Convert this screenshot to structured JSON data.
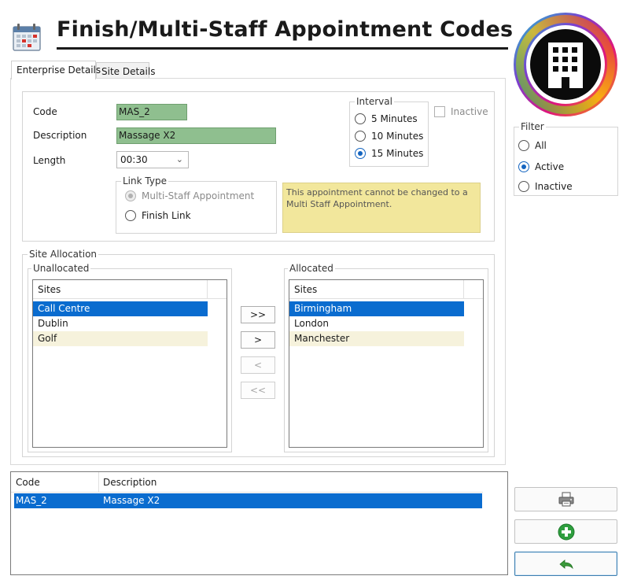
{
  "header": {
    "title": "Finish/Multi-Staff Appointment Codes"
  },
  "tabs": [
    {
      "label": "Enterprise Details",
      "active": true
    },
    {
      "label": "Site Details",
      "active": false
    }
  ],
  "form": {
    "code_label": "Code",
    "code_value": "MAS_2",
    "description_label": "Description",
    "description_value": "Massage X2",
    "length_label": "Length",
    "length_value": "00:30",
    "inactive_label": "Inactive",
    "inactive_checked": false
  },
  "interval": {
    "legend": "Interval",
    "options": [
      {
        "label": "5 Minutes",
        "selected": false
      },
      {
        "label": "10 Minutes",
        "selected": false
      },
      {
        "label": "15 Minutes",
        "selected": true
      }
    ]
  },
  "link_type": {
    "legend": "Link Type",
    "options": [
      {
        "label": "Multi-Staff Appointment",
        "selected": true,
        "disabled": true
      },
      {
        "label": "Finish Link",
        "selected": false,
        "disabled": false
      }
    ]
  },
  "note": "This appointment cannot be changed to a Multi Staff Appointment.",
  "site_allocation": {
    "legend": "Site Allocation",
    "unallocated": {
      "legend": "Unallocated",
      "header": "Sites",
      "items": [
        "Call Centre",
        "Dublin",
        "Golf"
      ]
    },
    "allocated": {
      "legend": "Allocated",
      "header": "Sites",
      "items": [
        "Birmingham",
        "London",
        "Manchester"
      ]
    },
    "buttons": {
      "move_all_right": ">>",
      "move_right": ">",
      "move_left": "<",
      "move_all_left": "<<"
    }
  },
  "grid": {
    "columns": [
      "Code",
      "Description"
    ],
    "rows": [
      {
        "code": "MAS_2",
        "description": "Massage X2"
      }
    ]
  },
  "filter": {
    "legend": "Filter",
    "options": [
      {
        "label": "All",
        "selected": false
      },
      {
        "label": "Active",
        "selected": true
      },
      {
        "label": "Inactive",
        "selected": false
      }
    ]
  },
  "actions": {
    "print_icon": "printer-icon",
    "add_icon": "plus-circle-icon",
    "undo_icon": "undo-arrow-icon"
  },
  "colors": {
    "selection": "#0a6ccf",
    "required_field": "#8fbf8f",
    "note_background": "#f2e79c",
    "add_green": "#2e9e3e"
  }
}
